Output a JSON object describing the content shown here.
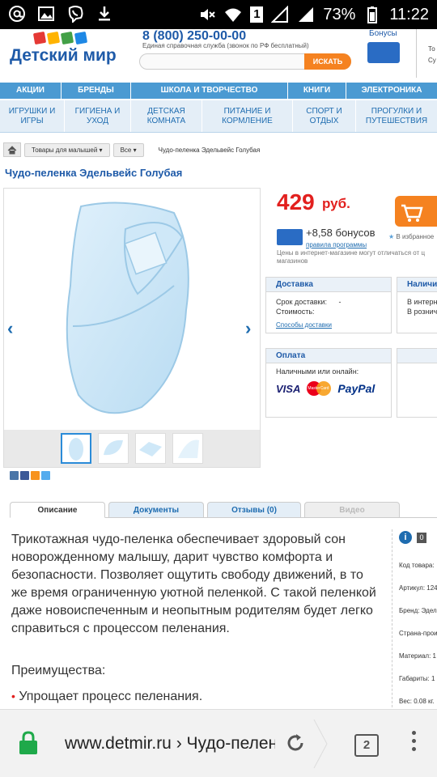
{
  "status_bar": {
    "battery": "73%",
    "time": "11:22",
    "sim_badge": "1"
  },
  "header": {
    "logo_text": "Детский мир",
    "phone": "8 (800) 250-00-00",
    "phone_sub": "Единая справочная служба (звонок по РФ бесплатный)",
    "search_button": "ИСКАТЬ",
    "bonus_label": "Бонусы",
    "cart_fragment": [
      "То",
      "Су"
    ]
  },
  "nav_top": [
    "АКЦИИ",
    "БРЕНДЫ",
    "ШКОЛА И ТВОРЧЕСТВО",
    "КНИГИ",
    "ЭЛЕКТРОНИКА"
  ],
  "nav_sub": [
    "ИГРУШКИ И ИГРЫ",
    "ГИГИЕНА И УХОД",
    "ДЕТСКАЯ КОМНАТА",
    "ПИТАНИЕ И КОРМЛЕНИЕ",
    "СПОРТ И ОТДЫХ",
    "ПРОГУЛКИ И ПУТЕШЕСТВИЯ"
  ],
  "breadcrumbs": {
    "items": [
      "Товары для малышей ▾",
      "Все ▾"
    ],
    "current": "Чудо-пеленка Эдельвейс Голубая"
  },
  "product": {
    "title": "Чудо-пеленка Эдельвейс Голубая",
    "price": "429",
    "currency": "руб.",
    "bonus": "+8,58 бонусов",
    "bonus_rules": "правила программы",
    "favorites": "В избранное",
    "price_note": "Цены в интернет-магазине могут отличаться от ц магазинов"
  },
  "delivery": {
    "title": "Доставка",
    "term_label": "Срок доставки:",
    "term_value": "-",
    "cost_label": "Стоимость:",
    "link": "Способы доставки"
  },
  "availability": {
    "title": "Наличи",
    "line1": "В интерн",
    "line2": "В розничн"
  },
  "payment": {
    "title": "Оплата",
    "subtitle": "Наличными или онлайн:",
    "visa": "VISA",
    "mastercard": "MasterCard",
    "paypal": "PayPal"
  },
  "tabs": [
    "Описание",
    "Документы",
    "Отзывы (0)",
    "Видео"
  ],
  "description": {
    "text": "Трикотажная чудо-пеленка обеспечивает здоровый сон новорожденному малышу, дарит чувство комфорта и безопасности. Позволяет ощутить свободу движений, в то же время ограниченную уютной пеленкой. С такой пеленкой даже новоиспеченным и неопытным родителям будет легко справиться с процессом пеленания.",
    "advantages_title": "Преимущества:",
    "bullet1": "Упрощает процесс пеленания."
  },
  "specs": {
    "count": "0",
    "rows": [
      "Код товара:",
      "Артикул: 124",
      "Бренд: Эдел",
      "Страна-прои",
      "Материал: 1",
      "Габариты: 1",
      "Вес: 0.08 кг."
    ]
  },
  "browser": {
    "url_domain": "www.detmir.ru",
    "url_rest": " › Чудо-пеленка Эдельвейс",
    "tab_count": "2"
  },
  "colors": {
    "brand_blue": "#1e5aa8",
    "nav_blue": "#4b9ad2",
    "price_red": "#e2201e",
    "accent_orange": "#f58220",
    "lock_green": "#1fa94a"
  }
}
